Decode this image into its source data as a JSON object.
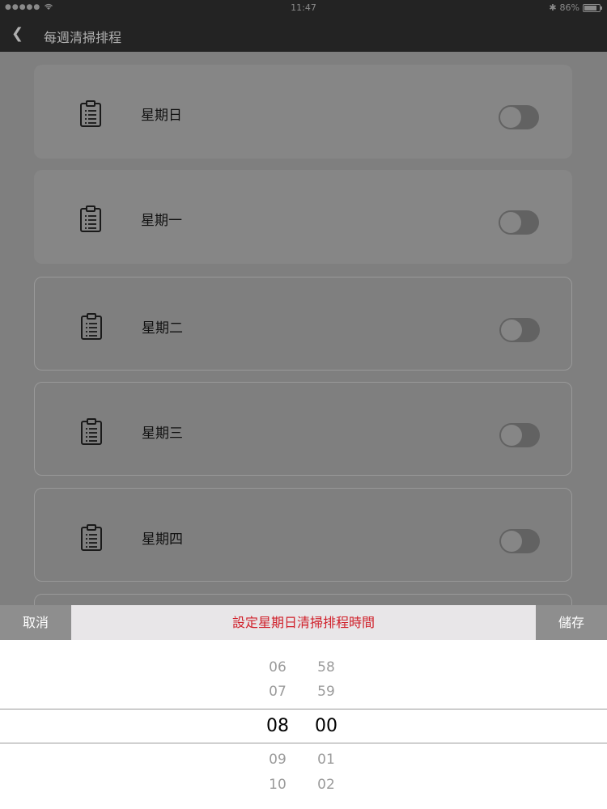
{
  "status": {
    "signal": "●●●●●",
    "wifi_icon": "wifi-icon",
    "time": "11:47",
    "bluetooth": "✱",
    "battery_text": "86%",
    "battery_level": 0.86
  },
  "nav": {
    "back": "❮",
    "title": "每週清掃排程"
  },
  "days": [
    {
      "label": "星期日"
    },
    {
      "label": "星期一"
    },
    {
      "label": "星期二"
    },
    {
      "label": "星期三"
    },
    {
      "label": "星期四"
    }
  ],
  "picker": {
    "cancel": "取消",
    "title": "設定星期日清掃排程時間",
    "save": "儲存",
    "hours": [
      "06",
      "07",
      "08",
      "09",
      "10"
    ],
    "minutes": [
      "58",
      "59",
      "00",
      "01",
      "02"
    ],
    "selected_hour": "08",
    "selected_minute": "00"
  },
  "colors": {
    "accent_red": "#d0202a",
    "header_dark": "#232323"
  }
}
